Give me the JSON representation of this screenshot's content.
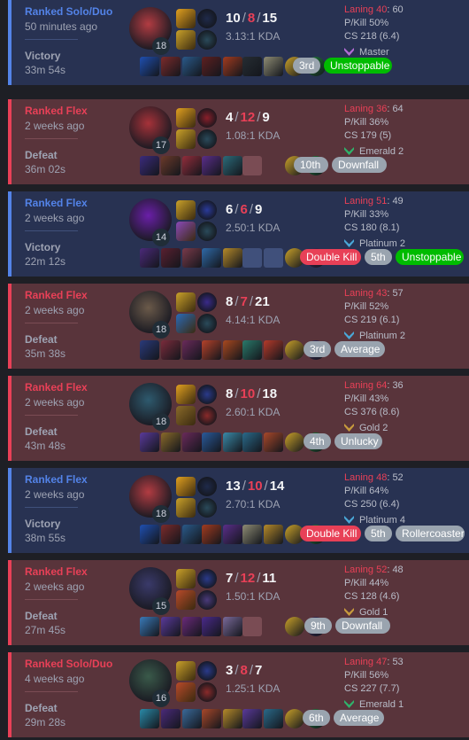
{
  "matches": [
    {
      "result_class": "win",
      "queue": "Ranked Solo/Duo",
      "ago": "50 minutes ago",
      "result": "Victory",
      "duration": "33m 54s",
      "champ_level": "18",
      "champ_color": "#b23c42",
      "kills": "10",
      "deaths": "8",
      "assists": "15",
      "kda": "3.13:1 KDA",
      "laning_label": "Laning 40",
      "laning_opp": ": 60",
      "pkill": "P/Kill 50%",
      "cs": "CS 218 (6.4)",
      "rank": "Master",
      "rank_color": "#b36bd6",
      "items": [
        "#1f4fb0",
        "#7c2b2b",
        "#2a5a8a",
        "#5e2020",
        "#a23b1f",
        "#262d33",
        "#8e8c74",
        "#c9a12a",
        "#1f7d3a"
      ],
      "badges": [
        {
          "text": "3rd",
          "style": "b-place"
        },
        {
          "text": "Unstoppable",
          "style": "b-green"
        }
      ]
    },
    {
      "result_class": "loss",
      "queue": "Ranked Flex",
      "ago": "2 weeks ago",
      "result": "Defeat",
      "duration": "36m 02s",
      "champ_level": "17",
      "champ_color": "#a63239",
      "kills": "4",
      "deaths": "12",
      "assists": "9",
      "kda": "1.08:1 KDA",
      "laning_label": "Laning 36",
      "laning_opp": ": 64",
      "pkill": "P/Kill 36%",
      "cs": "CS 179 (5)",
      "rank": "Emerald 2",
      "rank_color": "#2fb36b",
      "items": [
        "#3b2b7c",
        "#6b3a2a",
        "#922d3b",
        "#5a2e8a",
        "#2b6b7a",
        "empty",
        "",
        "#c9a12a",
        "#1f7d3a"
      ],
      "badges": [
        {
          "text": "10th",
          "style": "b-place"
        },
        {
          "text": "Downfall",
          "style": "b-grey"
        }
      ]
    },
    {
      "result_class": "win",
      "queue": "Ranked Flex",
      "ago": "2 weeks ago",
      "result": "Victory",
      "duration": "22m 12s",
      "champ_level": "14",
      "champ_color": "#6a1fa8",
      "kills": "6",
      "deaths": "6",
      "assists": "9",
      "kda": "2.50:1 KDA",
      "laning_label": "Laning 51",
      "laning_opp": ": 49",
      "pkill": "P/Kill 33%",
      "cs": "CS 180 (8.1)",
      "rank": "Platinum 2",
      "rank_color": "#4aa8d8",
      "items": [
        "#4b2a7a",
        "#5a2030",
        "#7a3a4a",
        "#2f6aa8",
        "#b58a2a",
        "empty",
        "empty",
        "#c9a12a",
        "#3a2a5a"
      ],
      "badges": [
        {
          "text": "Double Kill",
          "style": "b-red"
        },
        {
          "text": "5th",
          "style": "b-place"
        },
        {
          "text": "Unstoppable",
          "style": "b-green"
        }
      ]
    },
    {
      "result_class": "loss",
      "queue": "Ranked Flex",
      "ago": "2 weeks ago",
      "result": "Defeat",
      "duration": "35m 38s",
      "champ_level": "18",
      "champ_color": "#6b5a4a",
      "kills": "8",
      "deaths": "7",
      "assists": "21",
      "kda": "4.14:1 KDA",
      "laning_label": "Laning 43",
      "laning_opp": ": 57",
      "pkill": "P/Kill 52%",
      "cs": "CS 219 (6.1)",
      "rank": "Platinum 2",
      "rank_color": "#4aa8d8",
      "items": [
        "#2a3a7a",
        "#7a2b3b",
        "#6a2a5a",
        "#b5422a",
        "#a8481f",
        "#2a7a6a",
        "#b53a2a",
        "#c9a12a",
        "#3a2a5a"
      ],
      "badges": [
        {
          "text": "3rd",
          "style": "b-place"
        },
        {
          "text": "Average",
          "style": "b-grey"
        }
      ]
    },
    {
      "result_class": "loss",
      "queue": "Ranked Flex",
      "ago": "2 weeks ago",
      "result": "Defeat",
      "duration": "43m 48s",
      "champ_level": "18",
      "champ_color": "#2e5a6e",
      "kills": "8",
      "deaths": "10",
      "assists": "18",
      "kda": "2.60:1 KDA",
      "laning_label": "Laning 64",
      "laning_opp": ": 36",
      "pkill": "P/Kill 43%",
      "cs": "CS 376 (8.6)",
      "rank": "Gold 2",
      "rank_color": "#c89b3c",
      "items": [
        "#5a3a9a",
        "#8a6a2a",
        "#6a2a5a",
        "#2a5a9a",
        "#3a8aa8",
        "#2a6a8a",
        "#a8482a",
        "#c9a12a",
        "#1f7d3a"
      ],
      "badges": [
        {
          "text": "4th",
          "style": "b-place"
        },
        {
          "text": "Unlucky",
          "style": "b-grey"
        }
      ]
    },
    {
      "result_class": "win",
      "queue": "Ranked Flex",
      "ago": "2 weeks ago",
      "result": "Victory",
      "duration": "38m 55s",
      "champ_level": "18",
      "champ_color": "#b23c42",
      "kills": "13",
      "deaths": "10",
      "assists": "14",
      "kda": "2.70:1 KDA",
      "laning_label": "Laning 48",
      "laning_opp": ": 52",
      "pkill": "P/Kill 64%",
      "cs": "CS 250 (6.4)",
      "rank": "Platinum 4",
      "rank_color": "#4aa8d8",
      "items": [
        "#1f4fb0",
        "#7c2b2b",
        "#2a5a8a",
        "#a23b1f",
        "#5a2e8a",
        "#8e8c74",
        "#b58a2a",
        "#c9a12a",
        "#1f7d3a"
      ],
      "badges": [
        {
          "text": "Double Kill",
          "style": "b-red"
        },
        {
          "text": "5th",
          "style": "b-place"
        },
        {
          "text": "Rollercoaster",
          "style": "b-grey"
        }
      ]
    },
    {
      "result_class": "loss",
      "queue": "Ranked Flex",
      "ago": "2 weeks ago",
      "result": "Defeat",
      "duration": "27m 45s",
      "champ_level": "15",
      "champ_color": "#3a3a6a",
      "kills": "7",
      "deaths": "12",
      "assists": "11",
      "kda": "1.50:1 KDA",
      "laning_label": "Laning 52",
      "laning_opp": ": 48",
      "pkill": "P/Kill 44%",
      "cs": "CS 128 (4.6)",
      "rank": "Gold 1",
      "rank_color": "#c89b3c",
      "items": [
        "#3a7ab8",
        "#5a3a9a",
        "#6a2a7a",
        "#4a2a8a",
        "#7a6a9a",
        "empty",
        "",
        "#c9a12a",
        "#3a2a5a"
      ],
      "badges": [
        {
          "text": "9th",
          "style": "b-place"
        },
        {
          "text": "Downfall",
          "style": "b-grey"
        }
      ]
    },
    {
      "result_class": "loss",
      "queue": "Ranked Solo/Duo",
      "ago": "4 weeks ago",
      "result": "Defeat",
      "duration": "29m 28s",
      "champ_level": "16",
      "champ_color": "#3a5a4a",
      "kills": "3",
      "deaths": "8",
      "assists": "7",
      "kda": "1.25:1 KDA",
      "laning_label": "Laning 47",
      "laning_opp": ": 53",
      "pkill": "P/Kill 56%",
      "cs": "CS 227 (7.7)",
      "rank": "Emerald 1",
      "rank_color": "#2fb36b",
      "items": [
        "#2a8aa8",
        "#4a2a7a",
        "#3a6a9a",
        "#a8482a",
        "#b58a2a",
        "#5a3a9a",
        "#2a6a8a",
        "#c9a12a",
        "#1f7d3a"
      ],
      "badges": [
        {
          "text": "6th",
          "style": "b-place"
        },
        {
          "text": "Average",
          "style": "b-grey"
        }
      ]
    }
  ],
  "spells": [
    [
      [
        "#e0a020",
        "#1f2a4a"
      ],
      [
        "#c9a12a",
        "#2a4a5a"
      ]
    ],
    [
      [
        "#e0a020",
        "#8a1f2a"
      ],
      [
        "#c9a12a",
        "#2a4a5a"
      ]
    ],
    [
      [
        "#c9a12a",
        "#2a3a9a"
      ],
      [
        "#8a4ab8",
        "#2a4a5a"
      ]
    ],
    [
      [
        "#c9a12a",
        "#3a2a8a"
      ],
      [
        "#2a6ab8",
        "#2a4a5a"
      ]
    ],
    [
      [
        "#e0a020",
        "#2a3a8a"
      ],
      [
        "#8a6a2a",
        "#8a2a2a"
      ]
    ],
    [
      [
        "#e0a020",
        "#1f2a4a"
      ],
      [
        "#c9a12a",
        "#2a4a5a"
      ]
    ],
    [
      [
        "#c9a12a",
        "#2a3a8a"
      ],
      [
        "#b84a2a",
        "#4a3a7a"
      ]
    ],
    [
      [
        "#c9a12a",
        "#2a3a8a"
      ],
      [
        "#b84a2a",
        "#8a2a2a"
      ]
    ]
  ]
}
